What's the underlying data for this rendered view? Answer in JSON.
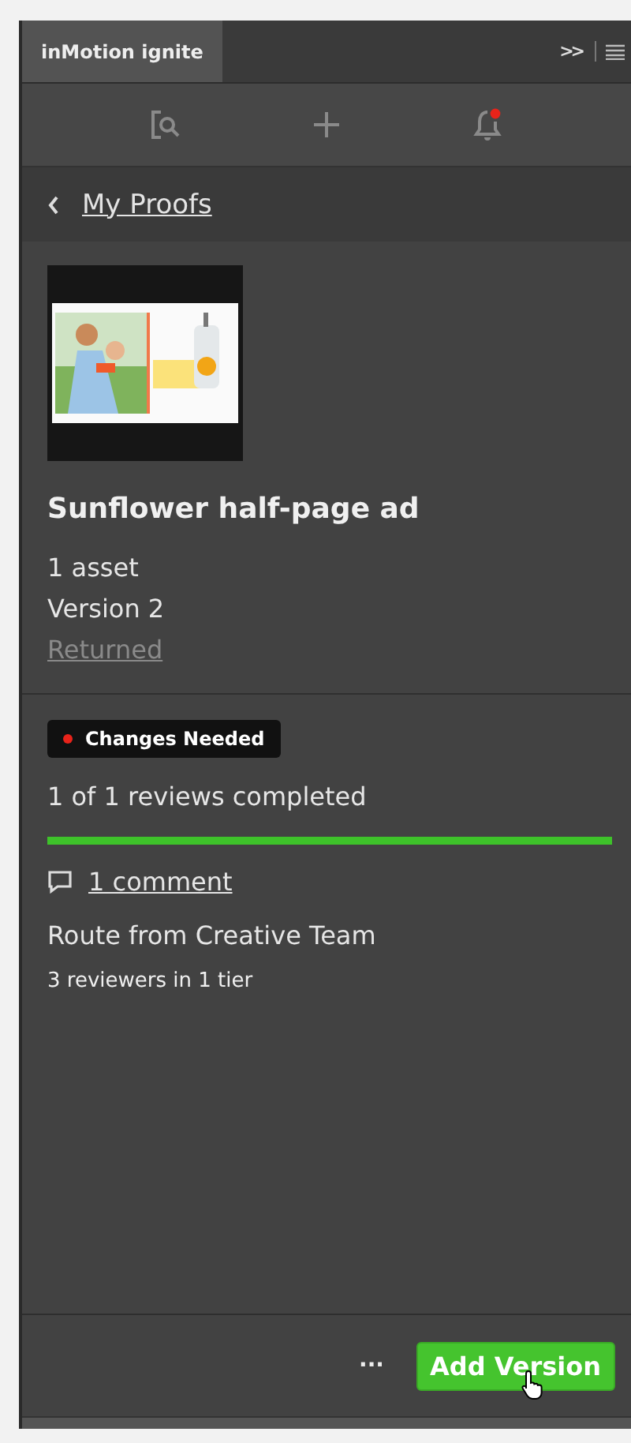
{
  "panel": {
    "tab": {
      "label": "inMotion ignite",
      "selected": true
    },
    "overflow": ">>"
  },
  "toolbar": {
    "notification_dot": true
  },
  "nav": {
    "back_label": "My Proofs"
  },
  "proof": {
    "title": "Sunflower half-page ad",
    "assets": "1 asset",
    "version": "Version 2",
    "status_link": "Returned"
  },
  "review": {
    "badge": {
      "label": "Changes Needed",
      "color": "#e8231a"
    },
    "summary": "1 of 1 reviews completed",
    "progress": {
      "level": 1.0
    },
    "comments": "1 comment",
    "route": "Route from Creative Team",
    "reviewers": "3 reviewers in 1 tier"
  },
  "footer": {
    "more": "···",
    "button": "Add Version"
  }
}
